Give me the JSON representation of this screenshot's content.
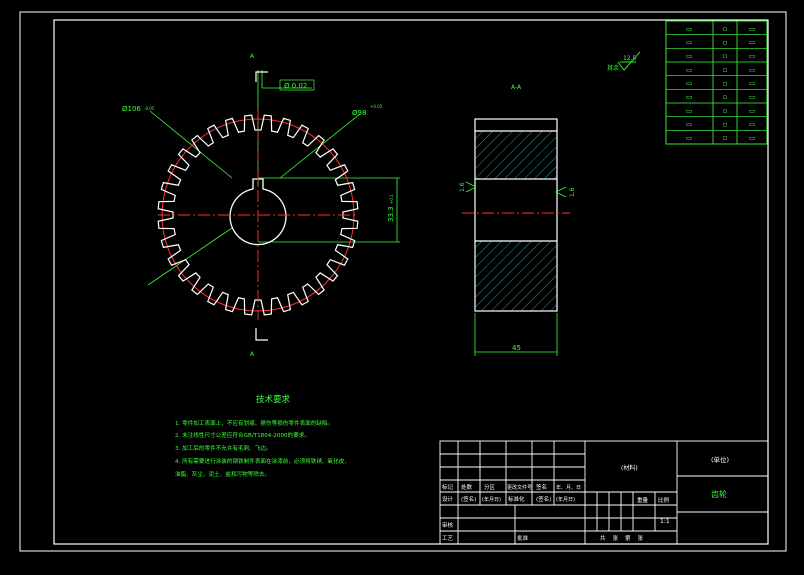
{
  "drawing": {
    "section_marker_top": "A",
    "section_marker_bottom": "A",
    "section_view_label": "A-A",
    "tolerance_frame": "Ø 0.02",
    "dim_outer_diameter": "Ø106",
    "dim_outer_tol": "-0.05",
    "dim_inner_diameter": "Ø98",
    "dim_inner_tol": "+0.05",
    "dim_keyway": "33.3",
    "dim_keyway_tol": "+0.1",
    "dim_width": "45",
    "roughness_left": "1.6",
    "roughness_right": "1.6",
    "roughness_general_value": "12.5",
    "roughness_general_note": "其余"
  },
  "tech_requirements": {
    "title": "技术要求",
    "lines": [
      "1. 零件加工表面上，不应有划痕、擦伤等损伤零件表面的缺陷。",
      "2. 未注线性尺寸公差应符合GB/T1804-2000的要求。",
      "3. 加工后的零件不允许有毛刺、飞边。",
      "4. 所有需要进行涂装的钢铁制件表面在涂漆前，必须将铁锈、氧化皮、",
      "油脂、灰尘、泥土、盐和污物等除去。"
    ]
  },
  "param_table": {
    "rows": [
      [
        "▭",
        "▫",
        "▭"
      ],
      [
        "▭",
        "▫",
        "▭"
      ],
      [
        "▭",
        "▫",
        "▭"
      ],
      [
        "▭",
        "▫",
        "▭"
      ],
      [
        "▭",
        "▫",
        "▭"
      ],
      [
        "▭",
        "▫",
        "▭"
      ],
      [
        "▭",
        "▫",
        "▭"
      ],
      [
        "▭",
        "▫",
        "▭"
      ],
      [
        "▭",
        "▫",
        "▭"
      ]
    ]
  },
  "title_block": {
    "material": "(材料)",
    "org": "(单位)",
    "part_name": "齿轮",
    "row1": [
      "标记",
      "处数",
      "分区",
      "更改文件号",
      "签名",
      "年、月、日"
    ],
    "row2": [
      "设计",
      "(签名)",
      "(年月日)",
      "标准化",
      "(签名)",
      "(年月日)"
    ],
    "row3_left": "审核",
    "row4": [
      "工艺",
      "批准"
    ],
    "weight_headers": [
      "重量",
      "比例"
    ],
    "scale": "1:1",
    "sheet_text": "共    张    第    张"
  },
  "colors": {
    "frame": "#ffffff",
    "annotation": "#3cff3c",
    "gear_outline": "#ffffff",
    "pitch_circle": "#ff3030",
    "centerline": "#ff3030",
    "hatch": "#28a8a8"
  }
}
